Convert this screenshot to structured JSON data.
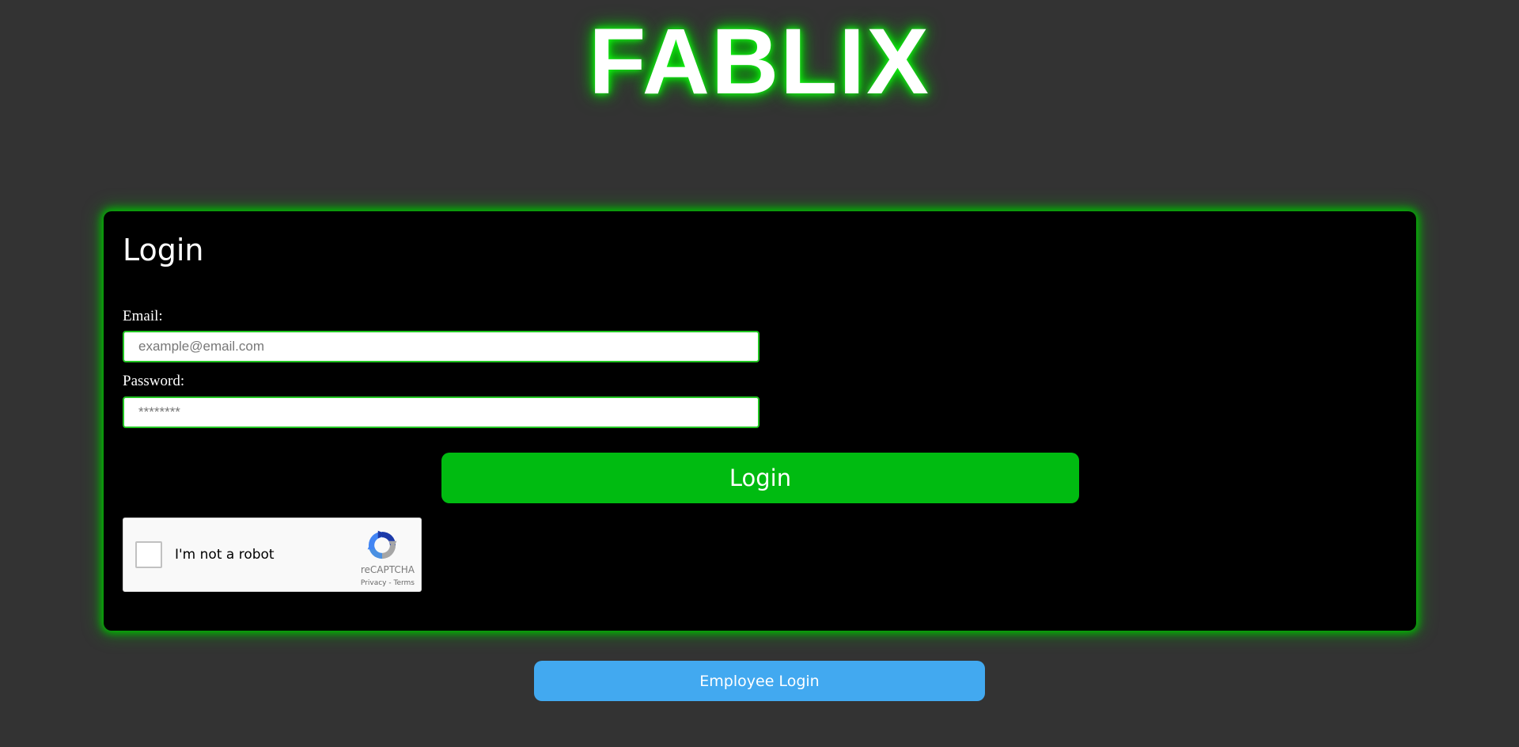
{
  "brand": {
    "title": "FABLIX",
    "glow_color": "#00dd00"
  },
  "login_form": {
    "title": "Login",
    "email": {
      "label": "Email:",
      "value": "",
      "placeholder": "example@email.com"
    },
    "password": {
      "label": "Password:",
      "value": "",
      "placeholder": "********"
    },
    "submit_label": "Login",
    "submit_color": "#00bb11"
  },
  "recaptcha": {
    "checked": false,
    "label": "I'm not a robot",
    "brand": "reCAPTCHA",
    "privacy_link": "Privacy",
    "separator": " - ",
    "terms_link": "Terms",
    "logo_icon": "recaptcha-logo-icon"
  },
  "employee_login": {
    "label": "Employee Login",
    "color": "#42a9f0"
  },
  "colors": {
    "page_background": "#333333",
    "card_background": "#000000",
    "card_glow": "#00bb00",
    "input_border": "#22c522"
  }
}
